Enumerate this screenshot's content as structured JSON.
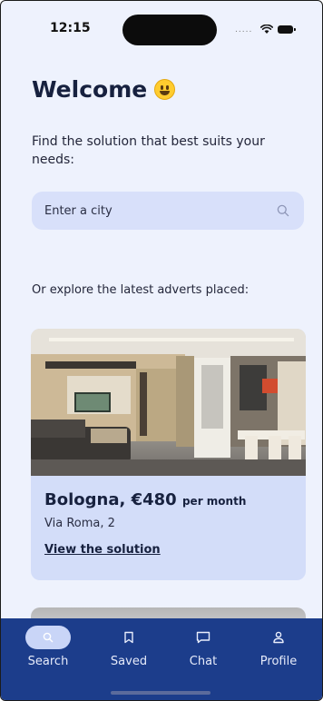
{
  "status_bar": {
    "time": "12:15",
    "signal": "....."
  },
  "welcome": {
    "title": "Welcome",
    "emoji_icon": "smiling-face-icon",
    "subtitle": "Find the solution that best suits your needs:"
  },
  "search": {
    "placeholder": "Enter a city",
    "value": "",
    "icon": "search-icon"
  },
  "explore_text": "Or explore the latest adverts placed:",
  "adverts": [
    {
      "city": "Bologna",
      "price": "€480",
      "price_unit": "per month",
      "address": "Via Roma, 2",
      "link_label": "View the solution"
    }
  ],
  "tabs": [
    {
      "label": "Search",
      "icon": "search-icon",
      "active": true
    },
    {
      "label": "Saved",
      "icon": "bookmark-icon",
      "active": false
    },
    {
      "label": "Chat",
      "icon": "chat-bubble-icon",
      "active": false
    },
    {
      "label": "Profile",
      "icon": "person-icon",
      "active": false
    }
  ],
  "colors": {
    "background": "#eef2fd",
    "primary": "#1c3d8b",
    "card": "#d3ddf9",
    "search_field": "#d8e0fa",
    "text_dark": "#17213f"
  }
}
